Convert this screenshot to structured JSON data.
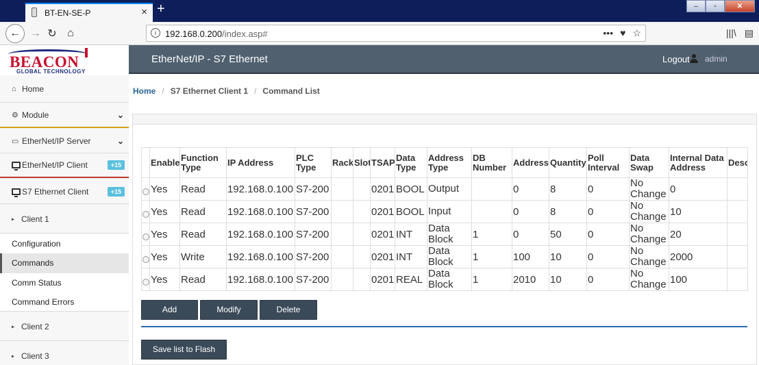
{
  "browser": {
    "tab_title": "BT-EN-SE-P",
    "tab_close": "×",
    "new_tab": "+",
    "url_host": "192.168.0.200",
    "url_path": "/index.asp#",
    "url_info": "i",
    "url_more": "•••",
    "url_pocket": "♥",
    "url_star": "☆",
    "nav_back": "←",
    "nav_forward": "→",
    "nav_reload": "↻",
    "nav_home": "⌂",
    "library": "|||\\",
    "sidebar_toggle": "▤",
    "win_min": "–",
    "win_max": "▫",
    "win_close": "✕"
  },
  "logo": {
    "word": "BEACON",
    "sub": "GLOBAL TECHNOLOGY"
  },
  "header": {
    "title": "EtherNet/IP - S7 Ethernet",
    "logout": "Logout",
    "user": "admin"
  },
  "sidebar": {
    "home": "Home",
    "module": "Module",
    "ethernetip_server": "EtherNet/IP Server",
    "ethernetip_client": "EtherNet/IP Client",
    "ethernetip_client_badge": "+15",
    "s7_client": "S7 Ethernet Client",
    "s7_client_badge": "+15",
    "client1": "Client 1",
    "configuration": "Configuration",
    "commands": "Commands",
    "comm_status": "Comm Status",
    "command_errors": "Command Errors",
    "client2": "Client 2",
    "client3": "Client 3",
    "home_icon": "⌂",
    "module_icon": "⚙",
    "server_icon": "▭",
    "chevron": "⌄",
    "caret": "▸"
  },
  "breadcrumb": {
    "home": "Home",
    "sep": "/",
    "client": "S7 Ethernet Client 1",
    "page": "Command List"
  },
  "table": {
    "headers": [
      "Enable",
      "Function Type",
      "IP Address",
      "PLC Type",
      "Rack",
      "Slot",
      "TSAP",
      "Data Type",
      "Address Type",
      "DB Number",
      "Address",
      "Quantity",
      "Poll Interval",
      "Data Swap",
      "Internal Data Address",
      "Desc"
    ],
    "rows": [
      [
        "Yes",
        "Read",
        "192.168.0.100",
        "S7-200",
        "",
        "",
        "0201",
        "BOOL",
        "Output",
        "",
        "0",
        "8",
        "0",
        "No Change",
        "0",
        ""
      ],
      [
        "Yes",
        "Read",
        "192.168.0.100",
        "S7-200",
        "",
        "",
        "0201",
        "BOOL",
        "Input",
        "",
        "0",
        "8",
        "0",
        "No Change",
        "10",
        ""
      ],
      [
        "Yes",
        "Read",
        "192.168.0.100",
        "S7-200",
        "",
        "",
        "0201",
        "INT",
        "Data Block",
        "1",
        "0",
        "50",
        "0",
        "No Change",
        "20",
        ""
      ],
      [
        "Yes",
        "Write",
        "192.168.0.100",
        "S7-200",
        "",
        "",
        "0201",
        "INT",
        "Data Block",
        "1",
        "100",
        "10",
        "0",
        "No Change",
        "2000",
        ""
      ],
      [
        "Yes",
        "Read",
        "192.168.0.100",
        "S7-200",
        "",
        "",
        "0201",
        "REAL",
        "Data Block",
        "1",
        "2010",
        "10",
        "0",
        "No Change",
        "100",
        ""
      ]
    ]
  },
  "buttons": {
    "add": "Add",
    "modify": "Modify",
    "delete": "Delete",
    "save": "Save list to Flash"
  }
}
